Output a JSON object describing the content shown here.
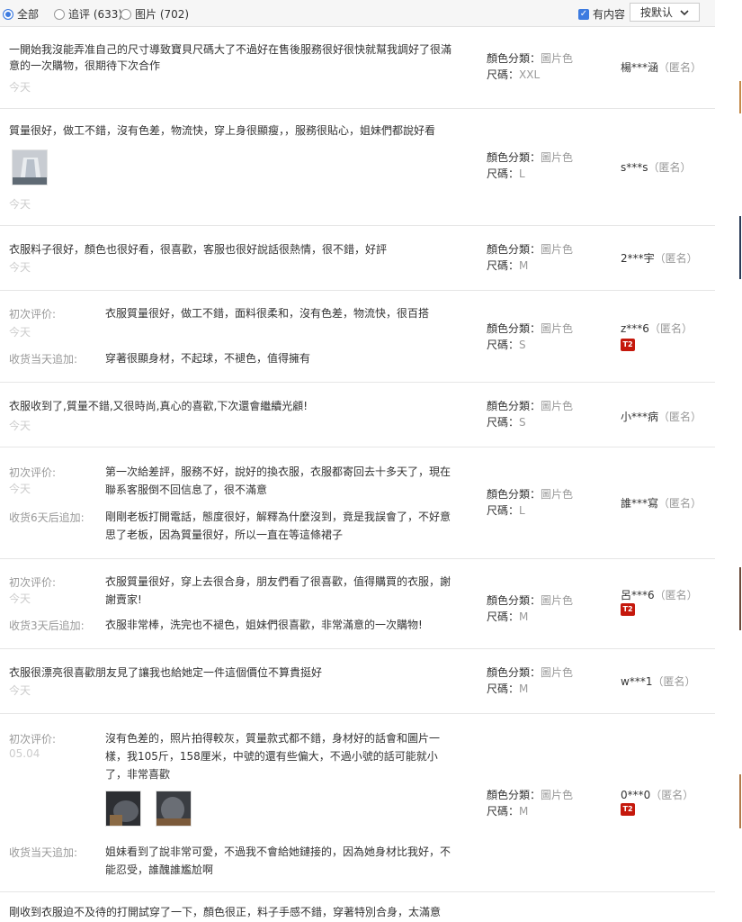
{
  "filters": {
    "all": "全部",
    "append": "追评 (633)",
    "pictures": "图片 (702)",
    "has_content": "有内容",
    "sort": "按默认"
  },
  "labels": {
    "color": "顏色分類：",
    "size": "尺碼：",
    "anon": "（匿名）",
    "first": "初次评价:"
  },
  "badge": "T2",
  "reviews": [
    {
      "text": "一開始我沒能弄准自己的尺寸導致寶貝尺碼大了不過好在售後服務很好很快就幫我調好了很滿意的一次購物，很期待下次合作",
      "date": "今天",
      "color": "圖片色",
      "size": "XXL",
      "user": "楊***涵"
    },
    {
      "text": "質量很好，做工不錯，沒有色差，物流快，穿上身很顯瘦，，服務很貼心，姐妹們都說好看",
      "date": "今天",
      "color": "圖片色",
      "size": "L",
      "user": "s***s"
    },
    {
      "text": "衣服料子很好，顏色也很好看，很喜歡，客服也很好說話很熱情，很不錯，好評",
      "date": "今天",
      "color": "圖片色",
      "size": "M",
      "user": "2***宇"
    },
    {
      "first": "衣服質量很好，做工不錯，面料很柔和，沒有色差，物流快，很百搭",
      "date": "今天",
      "append_label": "收货当天追加:",
      "append": "穿著很顯身材，不起球，不褪色，值得擁有",
      "color": "圖片色",
      "size": "S",
      "user": "z***6"
    },
    {
      "text": "衣服收到了,質量不錯,又很時尚,真心的喜歡,下次還會繼續光顧!",
      "date": "今天",
      "color": "圖片色",
      "size": "S",
      "user": "小***病"
    },
    {
      "first": "第一次給差評，服務不好，說好的換衣服，衣服都寄回去十多天了，現在聯系客服倒不回信息了，很不滿意",
      "date": "今天",
      "append_label": "收货6天后追加:",
      "append": "剛剛老板打開電話，態度很好，解釋為什麼沒到，竟是我誤會了，不好意思了老板，因為質量很好，所以一直在等這條裙子",
      "color": "圖片色",
      "size": "L",
      "user": "誰***寫"
    },
    {
      "first": "衣服質量很好，穿上去很合身，朋友們看了很喜歡，值得購買的衣服，謝謝賣家!",
      "date": "今天",
      "append_label": "收货3天后追加:",
      "append": "衣服非常棒，洗完也不褪色，姐妹們很喜歡，非常滿意的一次購物!",
      "color": "圖片色",
      "size": "M",
      "user": "呂***6"
    },
    {
      "text": "衣服很漂亮很喜歡朋友見了讓我也給她定一件這個價位不算貴挺好",
      "date": "今天",
      "color": "圖片色",
      "size": "M",
      "user": "w***1"
    },
    {
      "first": "沒有色差的，照片拍得較灰，質量款式都不錯，身材好的話會和圖片一樣，我105斤，158厘米，中號的還有些偏大，不過小號的話可能就小了，非常喜歡",
      "date": "05.04",
      "append_label": "收货当天追加:",
      "append": "姐妹看到了說非常可愛，不過我不會給她鏈接的，因為她身材比我好，不能忍受，誰醜誰尷尬啊",
      "color": "圖片色",
      "size": "M",
      "user": "0***0"
    },
    {
      "text": "剛收到衣服迫不及待的打開試穿了一下，顏色很正，料子手感不錯，穿著特別合身，太滿意"
    }
  ]
}
